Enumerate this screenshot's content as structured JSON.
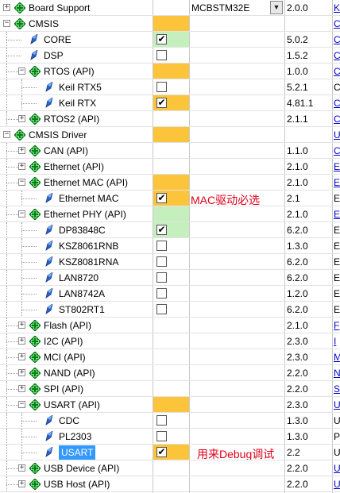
{
  "colors": {
    "required": "#fcc43a",
    "satisfied": "#c6efbe",
    "selection": "#3399ff",
    "annotation": "#e0001a"
  },
  "rows": [
    {
      "name": "Board Support",
      "level": 0,
      "toggle": "+",
      "icon": "green-diamond",
      "sel": "",
      "selBg": "",
      "variant": "MCBSTM32E",
      "dropdown": true,
      "version": "2.0.0",
      "desc": "K",
      "link": true
    },
    {
      "name": "CMSIS",
      "level": 0,
      "toggle": "-",
      "icon": "green-diamond",
      "sel": "",
      "selBg": "yellow",
      "variant": "",
      "version": "",
      "desc": "C",
      "link": true
    },
    {
      "name": "CORE",
      "level": 1,
      "toggle": "",
      "icon": "blue-gem",
      "sel": "checked",
      "selBg": "green",
      "variant": "",
      "version": "5.0.2",
      "desc": "C",
      "link": true
    },
    {
      "name": "DSP",
      "level": 1,
      "toggle": "",
      "icon": "blue-gem",
      "sel": "unchecked",
      "selBg": "",
      "variant": "",
      "version": "1.5.2",
      "desc": "C",
      "link": true
    },
    {
      "name": "RTOS (API)",
      "level": 1,
      "toggle": "-",
      "icon": "green-diamond",
      "sel": "",
      "selBg": "yellow",
      "variant": "",
      "version": "1.0.0",
      "desc": "C",
      "link": true
    },
    {
      "name": "Keil RTX5",
      "level": 2,
      "toggle": "",
      "icon": "blue-gem",
      "sel": "unchecked",
      "selBg": "",
      "variant": "",
      "version": "5.2.1",
      "desc": "C",
      "link": false
    },
    {
      "name": "Keil RTX",
      "level": 2,
      "toggle": "",
      "icon": "blue-gem",
      "sel": "checked",
      "selBg": "yellow",
      "variant": "",
      "version": "4.81.1",
      "desc": "C",
      "link": true
    },
    {
      "name": "RTOS2 (API)",
      "level": 1,
      "toggle": "+",
      "icon": "green-diamond",
      "sel": "",
      "selBg": "",
      "variant": "",
      "version": "2.1.1",
      "desc": "C",
      "link": true
    },
    {
      "name": "CMSIS Driver",
      "level": 0,
      "toggle": "-",
      "icon": "green-diamond",
      "sel": "",
      "selBg": "yellow",
      "variant": "",
      "version": "",
      "desc": "U",
      "link": true
    },
    {
      "name": "CAN (API)",
      "level": 1,
      "toggle": "+",
      "icon": "green-diamond",
      "sel": "",
      "selBg": "",
      "variant": "",
      "version": "1.1.0",
      "desc": "C",
      "link": true
    },
    {
      "name": "Ethernet (API)",
      "level": 1,
      "toggle": "+",
      "icon": "green-diamond",
      "sel": "",
      "selBg": "",
      "variant": "",
      "version": "2.1.0",
      "desc": "E",
      "link": true
    },
    {
      "name": "Ethernet MAC (API)",
      "level": 1,
      "toggle": "-",
      "icon": "green-diamond",
      "sel": "",
      "selBg": "yellow",
      "variant": "",
      "version": "2.1.0",
      "desc": "E",
      "link": true
    },
    {
      "name": "Ethernet MAC",
      "level": 2,
      "toggle": "",
      "icon": "blue-gem",
      "sel": "checked",
      "selBg": "yellow",
      "variant": "",
      "version": "2.1",
      "desc": "E",
      "link": false,
      "note": "MAC驱动必选"
    },
    {
      "name": "Ethernet PHY (API)",
      "level": 1,
      "toggle": "-",
      "icon": "green-diamond",
      "sel": "",
      "selBg": "green",
      "variant": "",
      "version": "2.1.0",
      "desc": "E",
      "link": true
    },
    {
      "name": "DP83848C",
      "level": 2,
      "toggle": "",
      "icon": "blue-gem",
      "sel": "checked",
      "selBg": "green",
      "variant": "",
      "version": "6.2.0",
      "desc": "E",
      "link": false
    },
    {
      "name": "KSZ8061RNB",
      "level": 2,
      "toggle": "",
      "icon": "blue-gem",
      "sel": "unchecked",
      "selBg": "",
      "variant": "",
      "version": "1.3.0",
      "desc": "E",
      "link": false
    },
    {
      "name": "KSZ8081RNA",
      "level": 2,
      "toggle": "",
      "icon": "blue-gem",
      "sel": "unchecked",
      "selBg": "",
      "variant": "",
      "version": "6.2.0",
      "desc": "E",
      "link": false
    },
    {
      "name": "LAN8720",
      "level": 2,
      "toggle": "",
      "icon": "blue-gem",
      "sel": "unchecked",
      "selBg": "",
      "variant": "",
      "version": "6.2.0",
      "desc": "E",
      "link": false
    },
    {
      "name": "LAN8742A",
      "level": 2,
      "toggle": "",
      "icon": "blue-gem",
      "sel": "unchecked",
      "selBg": "",
      "variant": "",
      "version": "1.2.0",
      "desc": "E",
      "link": false
    },
    {
      "name": "ST802RT1",
      "level": 2,
      "toggle": "",
      "icon": "blue-gem",
      "sel": "unchecked",
      "selBg": "",
      "variant": "",
      "version": "6.2.0",
      "desc": "E",
      "link": false
    },
    {
      "name": "Flash (API)",
      "level": 1,
      "toggle": "+",
      "icon": "green-diamond",
      "sel": "",
      "selBg": "",
      "variant": "",
      "version": "2.1.0",
      "desc": "F",
      "link": true
    },
    {
      "name": "I2C (API)",
      "level": 1,
      "toggle": "+",
      "icon": "green-diamond",
      "sel": "",
      "selBg": "",
      "variant": "",
      "version": "2.3.0",
      "desc": "I",
      "link": true
    },
    {
      "name": "MCI (API)",
      "level": 1,
      "toggle": "+",
      "icon": "green-diamond",
      "sel": "",
      "selBg": "",
      "variant": "",
      "version": "2.3.0",
      "desc": "M",
      "link": true
    },
    {
      "name": "NAND (API)",
      "level": 1,
      "toggle": "+",
      "icon": "green-diamond",
      "sel": "",
      "selBg": "",
      "variant": "",
      "version": "2.2.0",
      "desc": "N",
      "link": true
    },
    {
      "name": "SPI (API)",
      "level": 1,
      "toggle": "+",
      "icon": "green-diamond",
      "sel": "",
      "selBg": "",
      "variant": "",
      "version": "2.2.0",
      "desc": "S",
      "link": true
    },
    {
      "name": "USART (API)",
      "level": 1,
      "toggle": "-",
      "icon": "green-diamond",
      "sel": "",
      "selBg": "yellow",
      "variant": "",
      "version": "2.3.0",
      "desc": "U",
      "link": true
    },
    {
      "name": "CDC",
      "level": 2,
      "toggle": "",
      "icon": "blue-gem",
      "sel": "unchecked",
      "selBg": "",
      "variant": "",
      "version": "1.3.0",
      "desc": "U",
      "link": false
    },
    {
      "name": "PL2303",
      "level": 2,
      "toggle": "",
      "icon": "blue-gem",
      "sel": "unchecked",
      "selBg": "",
      "variant": "",
      "version": "1.3.0",
      "desc": "P",
      "link": false
    },
    {
      "name": "USART",
      "level": 2,
      "toggle": "",
      "icon": "blue-gem",
      "sel": "checked",
      "selBg": "yellow",
      "variant": "",
      "version": "2.2",
      "desc": "U",
      "link": false,
      "selected": true,
      "note": "用来Debug调试"
    },
    {
      "name": "USB Device (API)",
      "level": 1,
      "toggle": "+",
      "icon": "green-diamond",
      "sel": "",
      "selBg": "",
      "variant": "",
      "version": "2.2.0",
      "desc": "U",
      "link": true
    },
    {
      "name": "USB Host (API)",
      "level": 1,
      "toggle": "+",
      "icon": "green-diamond",
      "sel": "",
      "selBg": "",
      "variant": "",
      "version": "2.2.0",
      "desc": "U",
      "link": true
    }
  ]
}
